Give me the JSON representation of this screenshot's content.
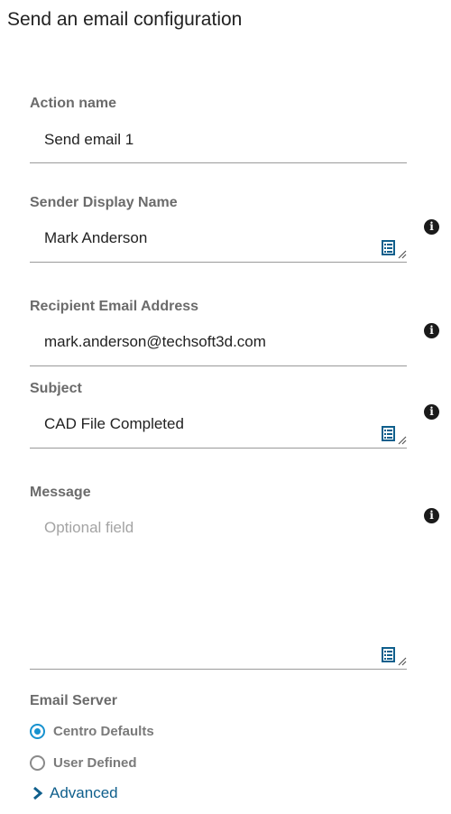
{
  "header": {
    "title": "Send an email configuration"
  },
  "fields": {
    "action_name": {
      "label": "Action name",
      "value": "Send email 1"
    },
    "sender_display_name": {
      "label": "Sender Display Name",
      "value": "Mark Anderson"
    },
    "recipient_email": {
      "label": "Recipient Email Address",
      "value": "mark.anderson@techsoft3d.com"
    },
    "subject": {
      "label": "Subject",
      "value": "CAD File Completed"
    },
    "message": {
      "label": "Message",
      "value": "",
      "placeholder": "Optional field"
    }
  },
  "email_server": {
    "label": "Email Server",
    "options": [
      {
        "label": "Centro Defaults",
        "selected": true
      },
      {
        "label": "User Defined",
        "selected": false
      }
    ]
  },
  "advanced": {
    "label": "Advanced"
  },
  "icons": {
    "info": "info-icon",
    "variables": "variables-list-icon",
    "resize": "resize-handle-icon",
    "expand": "chevron-right-icon"
  },
  "colors": {
    "accent": "#1792cf",
    "link": "#0f5f8c",
    "icon": "#0f5f8c"
  }
}
